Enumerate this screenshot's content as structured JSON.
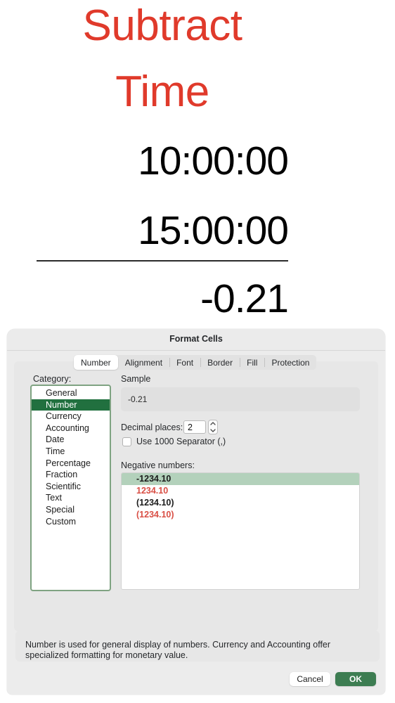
{
  "worksheet": {
    "title_line1": "Subtract",
    "title_line2": "Time",
    "title_color": "#e03a2b",
    "operand_1": "10:00:00",
    "operand_2": "15:00:00",
    "result": "-0.21"
  },
  "dialog": {
    "title": "Format Cells",
    "tabs": [
      {
        "label": "Number",
        "active": true
      },
      {
        "label": "Alignment",
        "active": false
      },
      {
        "label": "Font",
        "active": false
      },
      {
        "label": "Border",
        "active": false
      },
      {
        "label": "Fill",
        "active": false
      },
      {
        "label": "Protection",
        "active": false
      }
    ],
    "category": {
      "label": "Category:",
      "selected": "Number",
      "selected_color": "#21703f",
      "items": [
        "General",
        "Number",
        "Currency",
        "Accounting",
        "Date",
        "Time",
        "Percentage",
        "Fraction",
        "Scientific",
        "Text",
        "Special",
        "Custom"
      ]
    },
    "sample": {
      "label": "Sample",
      "value": "-0.21"
    },
    "decimal_places": {
      "label": "Decimal places:",
      "value": "2"
    },
    "thousand_separator": {
      "label": "Use 1000 Separator (,)",
      "checked": false
    },
    "negative_numbers": {
      "label": "Negative numbers:",
      "selected_index": 0,
      "highlight_color": "#b3d1bb",
      "items": [
        {
          "text": "-1234.10",
          "color": "#1b1b1b"
        },
        {
          "text": "1234.10",
          "color": "#d94f45"
        },
        {
          "text": "(1234.10)",
          "color": "#1b1b1b"
        },
        {
          "text": "(1234.10)",
          "color": "#d94f45"
        }
      ]
    },
    "description": "Number is used for general display of numbers.  Currency and Accounting offer specialized formatting for monetary value.",
    "buttons": {
      "cancel": "Cancel",
      "ok": "OK",
      "ok_color": "#3d7d52"
    }
  }
}
